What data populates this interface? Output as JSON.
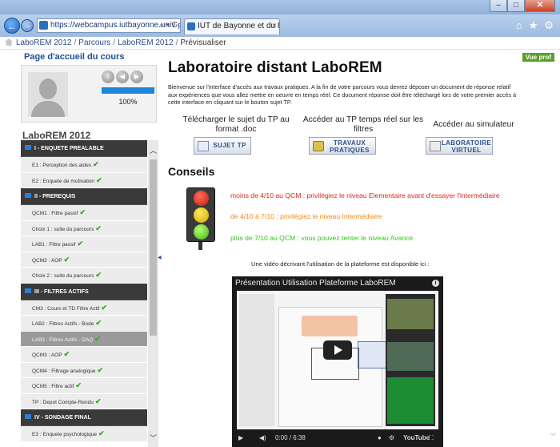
{
  "window": {
    "minimize": "–",
    "maximize": "□",
    "close": "✕"
  },
  "browser": {
    "address": "https://webcampus.iutbayonne.univ-pa...",
    "address_tools": "⌕ ▾ C",
    "tab_title": "IUT de Bayonne et du Pays ...",
    "tab_close": "×",
    "icons": [
      "home-icon",
      "star-icon",
      "gear-icon"
    ]
  },
  "breadcrumb": {
    "items": [
      "LaboREM 2012",
      "Parcours",
      "LaboREM 2012"
    ],
    "current": "Prévisualiser",
    "separator": "/"
  },
  "left": {
    "course_home": "Page d'accueil du cours",
    "progress_percent": 100,
    "progress_label": "100%",
    "course_title": "LaboREM 2012",
    "menu": [
      {
        "type": "section",
        "label": "I - ENQUETE PREALABLE"
      },
      {
        "type": "item",
        "label": "E1 : Perception des aides",
        "done": true
      },
      {
        "type": "item",
        "label": "E2 : Enquete de motivation",
        "done": true
      },
      {
        "type": "section",
        "label": "II - PREREQUIS"
      },
      {
        "type": "item",
        "label": "QCM1 : Filtre passif",
        "done": true
      },
      {
        "type": "item",
        "label": "Choix 1 : suite du parcours",
        "done": true
      },
      {
        "type": "item",
        "label": "LAB1 : Filtre passif",
        "done": true
      },
      {
        "type": "item",
        "label": "QCM2 : AOP",
        "done": true
      },
      {
        "type": "item",
        "label": "Choix 2 : suite du parcours",
        "done": true
      },
      {
        "type": "section",
        "label": "III - FILTRES ACTIFS"
      },
      {
        "type": "item",
        "label": "CM3 : Cours et TD Filtre Actif",
        "done": true
      },
      {
        "type": "item",
        "label": "LAB2 : Filtres Actifs - Bode",
        "done": true
      },
      {
        "type": "item",
        "label": "LAB3 : Filtres Actifs - DAQ",
        "done": true,
        "active": true
      },
      {
        "type": "item",
        "label": "QCM3 : AOP",
        "done": true
      },
      {
        "type": "item",
        "label": "QCM4 : Filtrage analogique",
        "done": true
      },
      {
        "type": "item",
        "label": "QCM5 : Filtre actif",
        "done": true
      },
      {
        "type": "item",
        "label": "TP : Depot Compte-Rendu",
        "done": true
      },
      {
        "type": "section",
        "label": "IV - SONDAGE FINAL"
      },
      {
        "type": "item",
        "label": "E3 : Enquete psychologique",
        "done": true
      }
    ]
  },
  "main": {
    "badge": "Vue prof",
    "title": "Laboratoire distant LaboREM",
    "intro": "Bienvenue sur l'interface d'accès aux travaux pratiques. A la fin de votre parcours vous devrez déposer un document de réponse relatif aux expériences que vous allez mettre en oeuvre en temps réel. Ce document réponse doit être téléchargé lors de votre premier accès à cette interface en cliquant sur le bouton sujet TP.",
    "actions": [
      {
        "caption": "Télécharger le sujet du TP au format .doc",
        "button": "SUJET TP",
        "icon": "doc-icon"
      },
      {
        "caption": "Accéder au TP temps réel sur les filtres",
        "button": "TRAVAUX PRATIQUES",
        "icon": "tools-icon"
      },
      {
        "caption": "Accéder au simulateur",
        "button": "LABORATOIRE VIRTUEL",
        "icon": "screen-icon"
      }
    ],
    "conseils_title": "Conseils",
    "advice": [
      {
        "text": "moins de 4/10 au QCM : privilégiez le niveau Elementaire  avant d'essayer l'intermédiaire",
        "color": "#e3231a"
      },
      {
        "text": "de 4/10 à 7/10 : privilégiez le niveau Intermédiaire",
        "color": "#f08a18"
      },
      {
        "text": "plus de 7/10 au QCM : vous pouvez tenter le niveau Avancé",
        "color": "#35c41e"
      }
    ],
    "video_note": "Une vidéo décrivant l'utilisation de la plateforme est disponible ici :",
    "video": {
      "title": "Présentation Utilisation Plateforme LaboREM",
      "time": "0:00 / 6:38",
      "brand": "YouTube"
    }
  },
  "colors": {
    "accent": "#1f4f93",
    "section_bg": "#3a3a3a",
    "badge": "#5aa028",
    "check": "#3aa52a"
  }
}
